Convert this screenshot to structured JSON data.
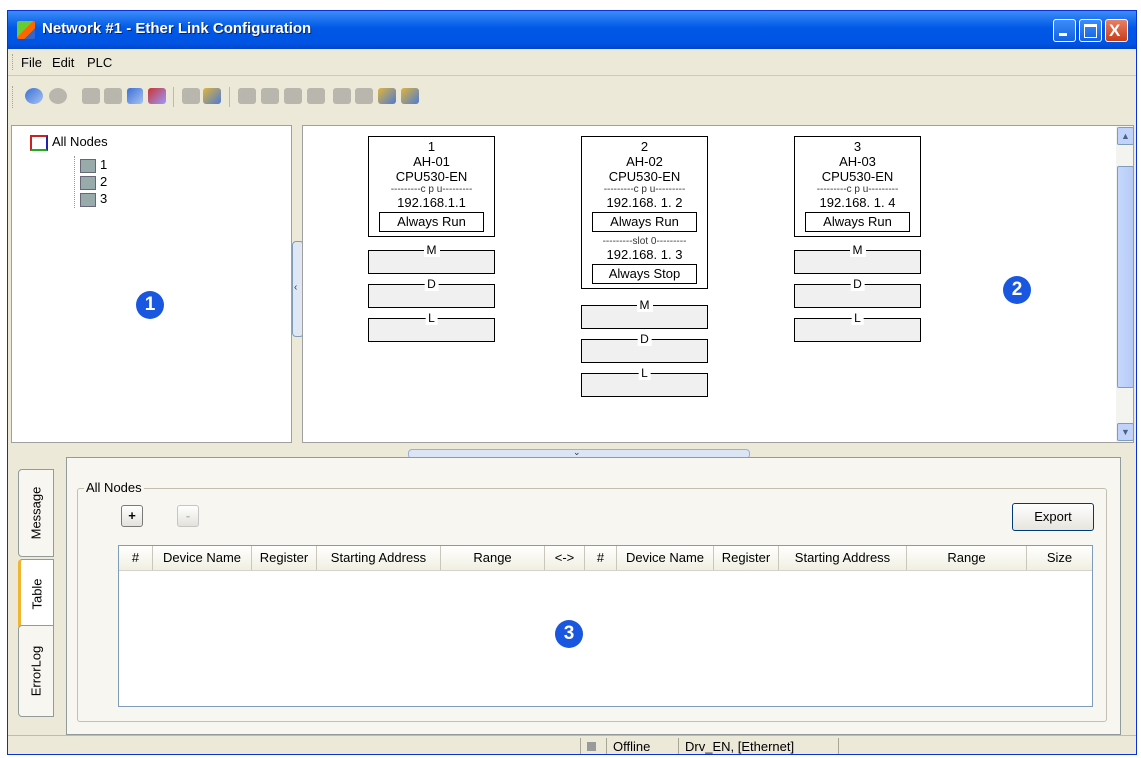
{
  "window": {
    "title": "Network #1 - Ether Link Configuration",
    "controls": {
      "minimize": "_",
      "maximize": "□",
      "close": "X"
    }
  },
  "menu": {
    "items": [
      "File",
      "Edit",
      "PLC"
    ]
  },
  "tree": {
    "root": "All Nodes",
    "children": [
      "1",
      "2",
      "3"
    ]
  },
  "markers": {
    "pane_left": "1",
    "pane_right": "2",
    "pane_bottom": "3"
  },
  "memory_labels": {
    "m": "M",
    "d": "D",
    "l": "L"
  },
  "nodes": [
    {
      "id": "1",
      "name": "AH-01",
      "model": "CPU530-EN",
      "cpu_label": "---------c p u---------",
      "ip": "192.168.1.1",
      "state": "Always Run"
    },
    {
      "id": "2",
      "name": "AH-02",
      "model": "CPU530-EN",
      "cpu_label": "---------c p u---------",
      "ip": "192.168.  1.  2",
      "state": "Always Run",
      "slot_label": "---------slot 0---------",
      "slot_ip": "192.168.  1.  3",
      "slot_state": "Always Stop"
    },
    {
      "id": "3",
      "name": "AH-03",
      "model": "CPU530-EN",
      "cpu_label": "---------c p u---------",
      "ip": "192.168.  1.  4",
      "state": "Always Run"
    }
  ],
  "side_tabs": {
    "message": "Message",
    "table": "Table",
    "errorlog": "ErrorLog"
  },
  "panel": {
    "group_title": "All Nodes",
    "add_label": "+",
    "remove_label": "-",
    "export_label": "Export"
  },
  "table": {
    "columns": [
      "#",
      "Device Name",
      "Register",
      "Starting Address",
      "Range",
      "<->",
      "#",
      "Device Name",
      "Register",
      "Starting Address",
      "Range",
      "Size"
    ]
  },
  "status": {
    "state": "Offline",
    "driver": "Drv_EN, [Ethernet]"
  }
}
